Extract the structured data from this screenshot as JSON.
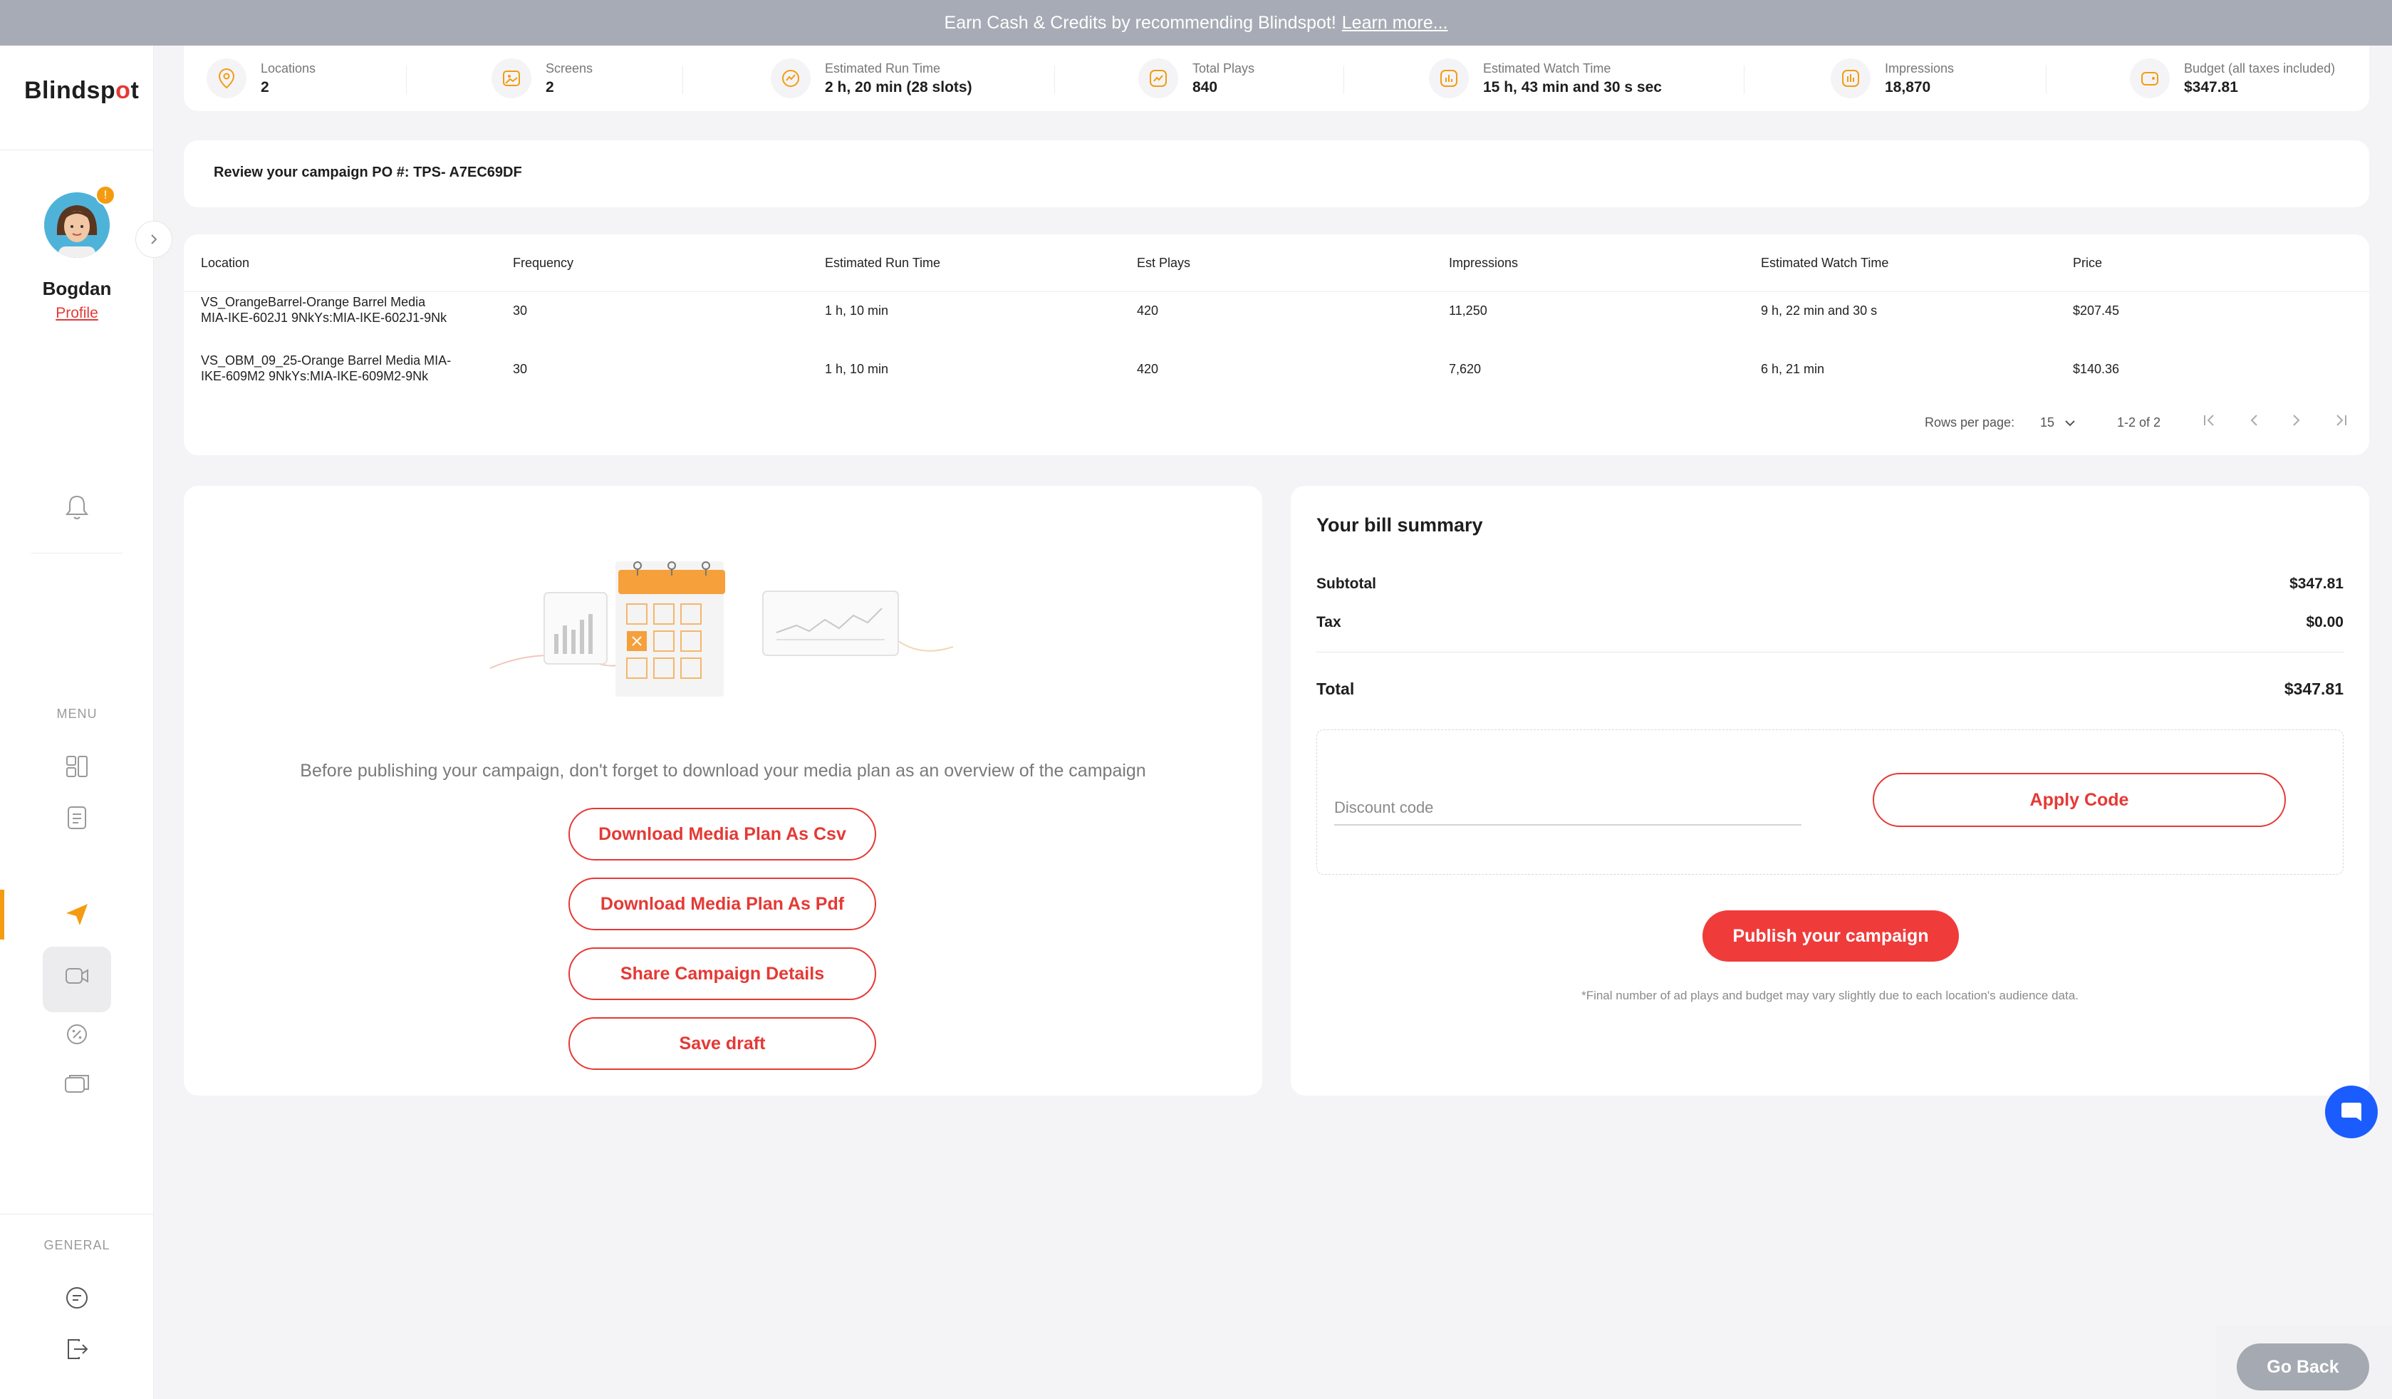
{
  "banner": {
    "text": "Earn Cash & Credits by recommending Blindspot!",
    "link": "Learn more..."
  },
  "sidebar": {
    "logo_main": "Bl",
    "logo_dot": "i",
    "logo_rest": "ndsp",
    "logo_accent": "o",
    "logo_end": "t",
    "user_name": "Bogdan",
    "profile_label": "Profile",
    "badge": "!",
    "menu_label": "MENU",
    "general_label": "GENERAL"
  },
  "stats": [
    {
      "label": "Locations",
      "value": "2",
      "icon": "location-icon"
    },
    {
      "label": "Screens",
      "value": "2",
      "icon": "screen-icon"
    },
    {
      "label": "Estimated Run Time",
      "value": "2 h, 20 min (28 slots)",
      "icon": "chart-icon"
    },
    {
      "label": "Total Plays",
      "value": "840",
      "icon": "plays-icon"
    },
    {
      "label": "Estimated Watch Time",
      "value": "15 h, 43 min and 30 s sec",
      "icon": "watch-icon"
    },
    {
      "label": "Impressions",
      "value": "18,870",
      "icon": "impressions-icon"
    },
    {
      "label": "Budget (all taxes included)",
      "value": "$347.81",
      "icon": "wallet-icon"
    }
  ],
  "po": {
    "text": "Review your campaign PO #: TPS- A7EC69DF"
  },
  "table": {
    "headers": [
      "Location",
      "Frequency",
      "Estimated Run Time",
      "Est Plays",
      "Impressions",
      "Estimated Watch Time",
      "Price"
    ],
    "rows": [
      {
        "location_1": "VS_OrangeBarrel-Orange Barrel Media",
        "location_2": "MIA-IKE-602J1 9NkYs:MIA-IKE-602J1-9Nk",
        "frequency": "30",
        "run_time": "1 h, 10 min",
        "plays": "420",
        "impressions": "11,250",
        "watch_time": "9 h, 22 min and 30 s",
        "price": "$207.45"
      },
      {
        "location_1": "VS_OBM_09_25-Orange Barrel Media MIA-",
        "location_2": "IKE-609M2 9NkYs:MIA-IKE-609M2-9Nk",
        "frequency": "30",
        "run_time": "1 h, 10 min",
        "plays": "420",
        "impressions": "7,620",
        "watch_time": "6 h, 21 min",
        "price": "$140.36"
      }
    ],
    "rows_per_page_label": "Rows per page:",
    "rows_per_page_value": "15",
    "range": "1-2 of 2"
  },
  "media_plan": {
    "hint": "Before publishing your campaign, don't forget to download your media plan as an overview of the campaign",
    "csv_button": "Download Media Plan As Csv",
    "pdf_button": "Download Media Plan As Pdf",
    "share_button": "Share Campaign Details",
    "draft_button": "Save draft"
  },
  "bill": {
    "title": "Your bill summary",
    "subtotal_label": "Subtotal",
    "subtotal_value": "$347.81",
    "tax_label": "Tax",
    "tax_value": "$0.00",
    "total_label": "Total",
    "total_value": "$347.81",
    "discount_placeholder": "Discount code",
    "apply_button": "Apply Code",
    "publish_button": "Publish your campaign",
    "fine_print": "*Final number of ad plays and budget may vary slightly due to each location's audience data."
  },
  "go_back": "Go Back",
  "colors": {
    "accent": "#e53935",
    "orange": "#f39c12",
    "chat": "#1a5cff",
    "banner": "#a7abb5"
  }
}
